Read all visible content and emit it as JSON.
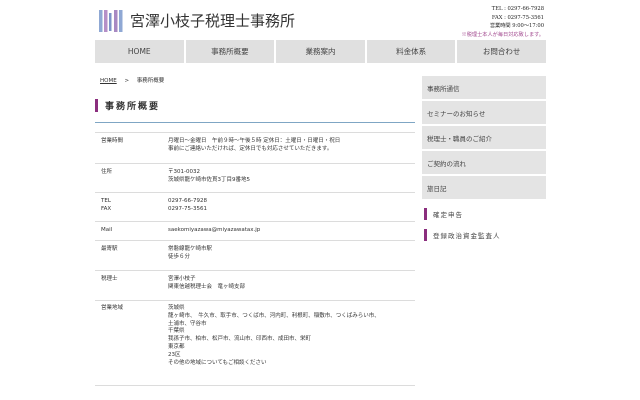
{
  "header": {
    "site_title": "宮澤小枝子税理士事務所",
    "tel": "TEL : 0297-66-7928",
    "fax": "FAX : 0297-75-3561",
    "hours": "営業時間 9:00〜17:00",
    "note": "※税理士本人が毎日対応致します。"
  },
  "nav": {
    "items": [
      {
        "label": "HOME"
      },
      {
        "label": "事務所概要"
      },
      {
        "label": "業務案内"
      },
      {
        "label": "料金体系"
      },
      {
        "label": "お問合わせ"
      }
    ]
  },
  "breadcrumb": {
    "home": "HOME",
    "separator": ">",
    "current": "事務所概要"
  },
  "page_title": "事務所概要",
  "info_rows": [
    {
      "label": "営業時間",
      "value": "月曜日〜金曜日　午前９時〜午後５時 定休日：土曜日・日曜日・祝日\n事前にご連絡いただければ、定休日でも対応させていただきます。"
    },
    {
      "label": "住所",
      "value": "〒301-0032\n茨城県龍ケ崎市佐貫3丁目9番地5"
    },
    {
      "label": "TEL\nFAX",
      "value": "0297-66-7928\n0297-75-3561"
    },
    {
      "label": "Mail",
      "value": "saekomiyazawa@miyazawatax.jp"
    },
    {
      "label": "最寄駅",
      "value": "常磐線龍ケ崎市駅\n徒歩６分"
    },
    {
      "label": "税理士",
      "value": "宮澤小枝子\n関東信越税理士会　竜ヶ崎支部"
    },
    {
      "label": "営業地域",
      "value": "茨城県\n龍ヶ崎市、　牛久市、取手市、つくば市、河内町、利根町、稲敷市、つくばみらい市、\n土浦市、守谷市\n千葉県\n我孫子市、柏市、松戸市、流山市、印西市、成田市、栄町\n東京都\n23区\nその他の地域についてもご相談ください"
    }
  ],
  "sidebar": {
    "items": [
      {
        "label": "事務所通信"
      },
      {
        "label": "セミナーのお知らせ"
      },
      {
        "label": "税理士・職員のご紹介"
      },
      {
        "label": "ご契約の流れ"
      },
      {
        "label": "旅日記"
      }
    ],
    "links": [
      {
        "label": "確定申告"
      },
      {
        "label": "登録政治資金監査人"
      }
    ]
  },
  "colors": {
    "accent": "#8b2e7e",
    "nav_bg": "#e0e0e0",
    "title_rule": "#7fa6c4"
  }
}
